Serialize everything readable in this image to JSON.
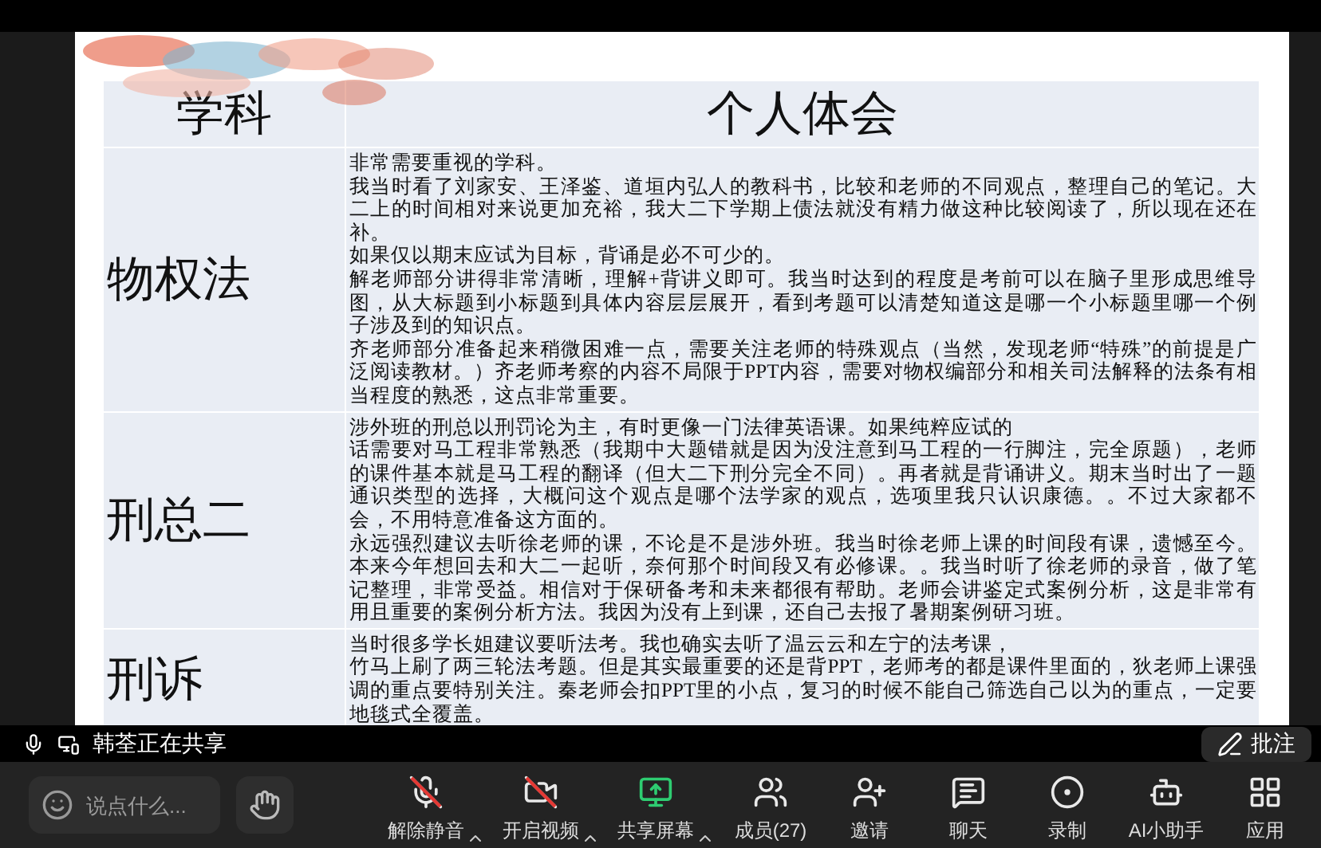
{
  "slide": {
    "table": {
      "columns": [
        "学科",
        "个人体会"
      ],
      "rows": [
        {
          "subject": "物权法",
          "paragraphs": [
            "非常需要重视的学科。",
            "我当时看了刘家安、王泽鉴、道垣内弘人的教科书，比较和老师的不同观点，整理自己的笔记。大二上的时间相对来说更加充裕，我大二下学期上债法就没有精力做这种比较阅读了，所以现在还在补。",
            "如果仅以期末应试为目标，背诵是必不可少的。",
            "解老师部分讲得非常清晰，理解+背讲义即可。我当时达到的程度是考前可以在脑子里形成思维导图，从大标题到小标题到具体内容层层展开，看到考题可以清楚知道这是哪一个小标题里哪一个例子涉及到的知识点。",
            "齐老师部分准备起来稍微困难一点，需要关注老师的特殊观点（当然，发现老师“特殊”的前提是广泛阅读教材。）齐老师考察的内容不局限于PPT内容，需要对物权编部分和相关司法解释的法条有相当程度的熟悉，这点非常重要。"
          ]
        },
        {
          "subject": "刑总二",
          "paragraphs": [
            "涉外班的刑总以刑罚论为主，有时更像一门法律英语课。如果纯粹应试的",
            "话需要对马工程非常熟悉（我期中大题错就是因为没注意到马工程的一行脚注，完全原题），老师的课件基本就是马工程的翻译（但大二下刑分完全不同）。再者就是背诵讲义。期末当时出了一题通识类型的选择，大概问这个观点是哪个法学家的观点，选项里我只认识康德。。不过大家都不会，不用特意准备这方面的。",
            "永远强烈建议去听徐老师的课，不论是不是涉外班。我当时徐老师上课的时间段有课，遗憾至今。本来今年想回去和大二一起听，奈何那个时间段又有必修课。。我当时听了徐老师的录音，做了笔记整理，非常受益。相信对于保研备考和未来都很有帮助。老师会讲鉴定式案例分析，这是非常有用且重要的案例分析方法。我因为没有上到课，还自己去报了暑期案例研习班。"
          ]
        },
        {
          "subject": "刑诉",
          "paragraphs": [
            "当时很多学长姐建议要听法考。我也确实去听了温云云和左宁的法考课，",
            "竹马上刷了两三轮法考题。但是其实最重要的还是背PPT，老师考的都是课件里面的，狄老师上课强调的重点要特别关注。秦老师会扣PPT里的小点，复习的时候不能自己筛选自己以为的重点，一定要地毯式全覆盖。"
          ]
        }
      ]
    }
  },
  "share_banner": {
    "text": "韩荃正在共享"
  },
  "annotate_button": {
    "label": "批注"
  },
  "toolbar": {
    "chat_input": {
      "placeholder": "说点什么..."
    },
    "buttons": [
      {
        "kind": "mic",
        "label": "解除静音",
        "off": true,
        "menu": true
      },
      {
        "kind": "video",
        "label": "开启视频",
        "off": true,
        "menu": true
      },
      {
        "kind": "share",
        "label": "共享屏幕",
        "off": false,
        "menu": true
      },
      {
        "kind": "members",
        "label": "成员(27)",
        "off": false,
        "menu": false
      },
      {
        "kind": "invite",
        "label": "邀请",
        "off": false,
        "menu": false
      },
      {
        "kind": "chat",
        "label": "聊天",
        "off": false,
        "menu": false
      },
      {
        "kind": "record",
        "label": "录制",
        "off": false,
        "menu": false
      },
      {
        "kind": "assistant",
        "label": "AI小助手",
        "off": false,
        "menu": false
      },
      {
        "kind": "apps",
        "label": "应用",
        "off": false,
        "menu": false
      }
    ]
  }
}
